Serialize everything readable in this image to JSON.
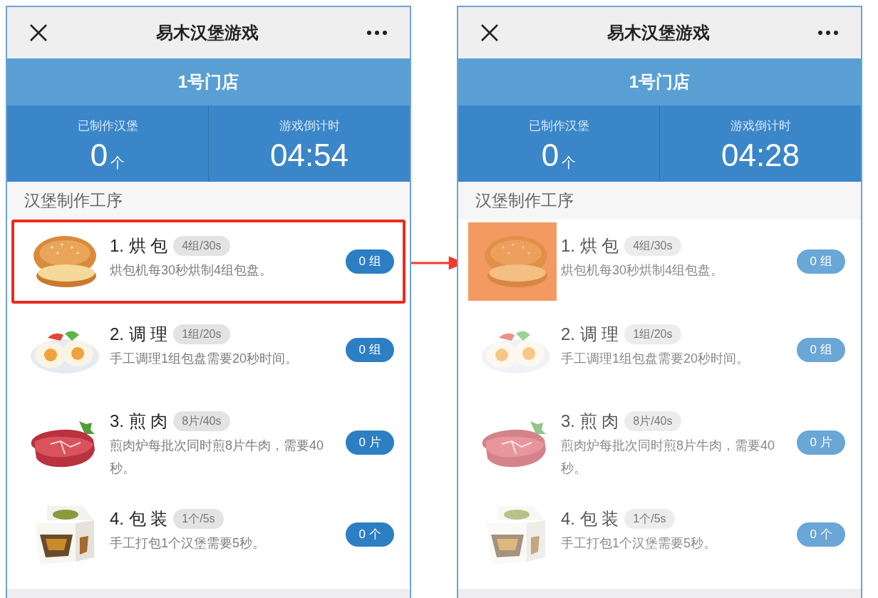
{
  "screens": [
    {
      "title": "易木汉堡游戏",
      "store": "1号门店",
      "made_label": "已制作汉堡",
      "made_value": "0",
      "made_unit": "个",
      "countdown_label": "游戏倒计时",
      "countdown": "04:54",
      "section_title": "汉堡制作工序",
      "dimmed": false,
      "drag_block": false,
      "steps": [
        {
          "kind": "bun",
          "title": "1. 烘 包",
          "rate": "4组/30s",
          "desc": "烘包机每30秒烘制4组包盘。",
          "count": "0 组",
          "highlighted": true
        },
        {
          "kind": "eggs",
          "title": "2. 调 理",
          "rate": "1组/20s",
          "desc": "手工调理1组包盘需要20秒时间。",
          "count": "0 组",
          "highlighted": false
        },
        {
          "kind": "steak",
          "title": "3. 煎 肉",
          "rate": "8片/40s",
          "desc": "煎肉炉每批次同时煎8片牛肉，需要40秒。",
          "count": "0 片",
          "highlighted": false
        },
        {
          "kind": "box",
          "title": "4. 包 装",
          "rate": "1个/5s",
          "desc": "手工打包1个汉堡需要5秒。",
          "count": "0 个",
          "highlighted": false
        }
      ]
    },
    {
      "title": "易木汉堡游戏",
      "store": "1号门店",
      "made_label": "已制作汉堡",
      "made_value": "0",
      "made_unit": "个",
      "countdown_label": "游戏倒计时",
      "countdown": "04:28",
      "section_title": "汉堡制作工序",
      "dimmed": true,
      "drag_block": true,
      "steps": [
        {
          "kind": "bun",
          "title": "1. 烘 包",
          "rate": "4组/30s",
          "desc": "烘包机每30秒烘制4组包盘。",
          "count": "0 组",
          "highlighted": false
        },
        {
          "kind": "eggs",
          "title": "2. 调 理",
          "rate": "1组/20s",
          "desc": "手工调理1组包盘需要20秒时间。",
          "count": "0 组",
          "highlighted": false
        },
        {
          "kind": "steak",
          "title": "3. 煎 肉",
          "rate": "8片/40s",
          "desc": "煎肉炉每批次同时煎8片牛肉，需要40秒。",
          "count": "0 片",
          "highlighted": false
        },
        {
          "kind": "box",
          "title": "4. 包 装",
          "rate": "1个/5s",
          "desc": "手工打包1个汉堡需要5秒。",
          "count": "0 个",
          "highlighted": false
        }
      ]
    }
  ]
}
